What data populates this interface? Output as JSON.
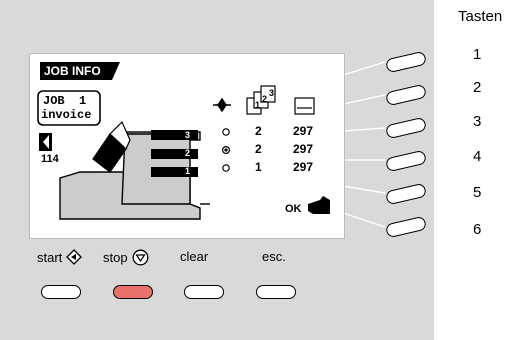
{
  "side_panel": {
    "title": "Tasten",
    "items": [
      "1",
      "2",
      "3",
      "4",
      "5",
      "6"
    ]
  },
  "screen": {
    "header": "JOB INFO",
    "job_line1": "JOB  1",
    "job_line2": "invoice",
    "counter": "114",
    "rows": [
      {
        "station": "3",
        "mode": "2",
        "length": "297",
        "selected": false
      },
      {
        "station": "2",
        "mode": "2",
        "length": "297",
        "selected": true
      },
      {
        "station": "1",
        "mode": "1",
        "length": "297",
        "selected": false
      }
    ],
    "ok_label": "OK",
    "icon_stack_digits": [
      "1",
      "2",
      "3"
    ]
  },
  "controls": {
    "start_label": "start",
    "stop_label": "stop",
    "clear_label": "clear",
    "esc_label": "esc."
  },
  "colors": {
    "panel": "#d9d9d9",
    "stop_button": "#e87269"
  }
}
